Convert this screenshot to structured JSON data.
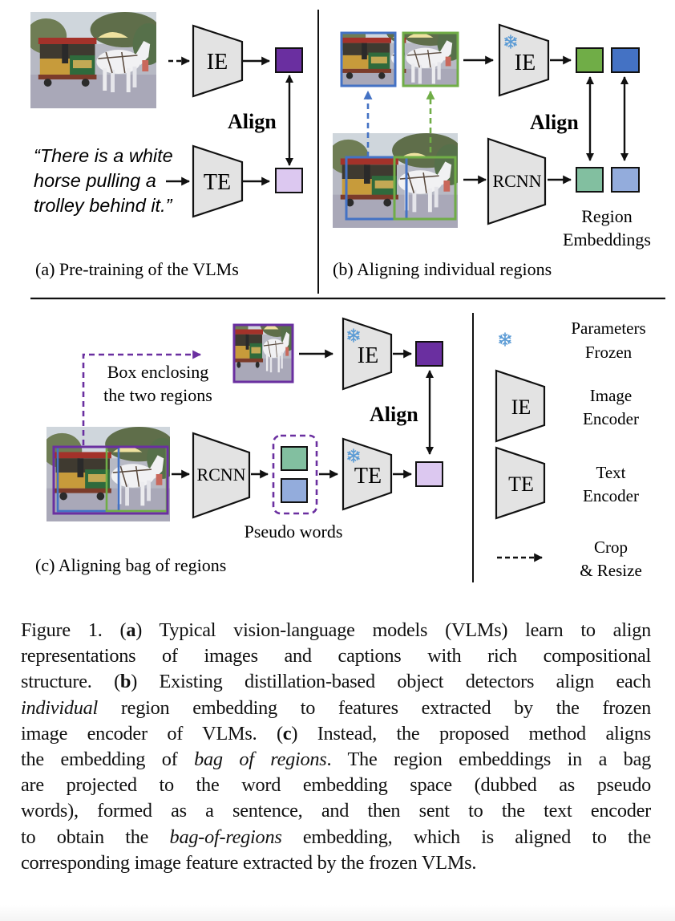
{
  "figure": {
    "colors": {
      "encoder_fill": "#e3e3e3",
      "purple_dark": "#6a2fa0",
      "purple_light": "#dcc8f0",
      "green": "#70ad47",
      "blue": "#4472c4",
      "teal": "#82bfa0",
      "light_blue": "#93acdc",
      "snowflake": "#5b9bd5",
      "line": "#111111"
    },
    "panel_a": {
      "caption": "(a) Pre-training of the VLMs",
      "caption_quote_lines": [
        "“There is a white",
        "horse pulling a",
        "trolley behind it.”"
      ],
      "image_encoder_label": "IE",
      "text_encoder_label": "TE",
      "align_label": "Align",
      "photo_alt": "horse-drawn trolley photo"
    },
    "panel_b": {
      "caption": "(b) Aligning individual regions",
      "image_encoder_label": "IE",
      "detector_label": "RCNN",
      "align_label": "Align",
      "region_embeddings_lines": [
        "Region",
        "Embeddings"
      ],
      "frozen_icon": "snowflake-icon"
    },
    "panel_c": {
      "caption": "(c) Aligning bag of regions",
      "box_label_lines": [
        "Box enclosing",
        "the two regions"
      ],
      "image_encoder_label": "IE",
      "text_encoder_label": "TE",
      "detector_label": "RCNN",
      "align_label": "Align",
      "pseudo_words_label": "Pseudo words"
    },
    "legend": {
      "items": [
        {
          "icon": "snowflake-icon",
          "lines": [
            "Parameters",
            "Frozen"
          ]
        },
        {
          "icon": "image-encoder-icon",
          "glyph": "IE",
          "lines": [
            "Image",
            "Encoder"
          ]
        },
        {
          "icon": "text-encoder-icon",
          "glyph": "TE",
          "lines": [
            "Text",
            "Encoder"
          ]
        },
        {
          "icon": "dashed-arrow-icon",
          "lines": [
            "Crop",
            "& Resize"
          ]
        }
      ]
    }
  },
  "caption": {
    "lines": [
      [
        {
          "t": "Figure 1. "
        },
        {
          "t": "(",
          "s": ""
        },
        {
          "t": "a",
          "s": "b"
        },
        {
          "t": ") Typical vision-language models (VLMs) learn to align"
        }
      ],
      [
        {
          "t": "representations of images and captions with rich compositional"
        }
      ],
      [
        {
          "t": "structure. ("
        },
        {
          "t": "b",
          "s": "b"
        },
        {
          "t": ") Existing distillation-based object detectors align each"
        }
      ],
      [
        {
          "t": "individual",
          "s": "i"
        },
        {
          "t": " region embedding to features extracted by the frozen"
        }
      ],
      [
        {
          "t": "image encoder of VLMs. ("
        },
        {
          "t": "c",
          "s": "b"
        },
        {
          "t": ") Instead, the proposed method aligns"
        }
      ],
      [
        {
          "t": "the embedding of "
        },
        {
          "t": "bag of regions",
          "s": "i"
        },
        {
          "t": ". The region embeddings in a bag"
        }
      ],
      [
        {
          "t": "are projected to the word embedding space (dubbed as pseudo"
        }
      ],
      [
        {
          "t": "words), formed as a sentence, and then sent to the text encoder"
        }
      ],
      [
        {
          "t": "to obtain the "
        },
        {
          "t": "bag-of-regions",
          "s": "i"
        },
        {
          "t": " embedding, which is aligned to the"
        }
      ],
      [
        {
          "t": "corresponding image feature extracted by the frozen VLMs."
        }
      ]
    ]
  }
}
